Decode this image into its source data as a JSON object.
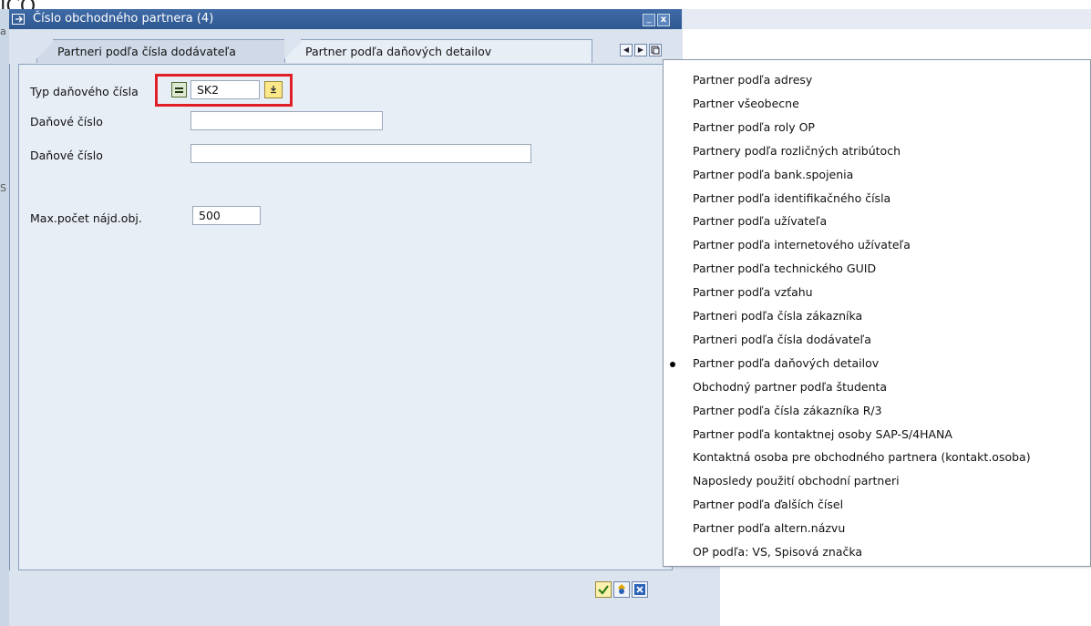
{
  "background": {
    "cut_text": "ICO.",
    "left_labels": [
      "a",
      "S"
    ]
  },
  "dialog": {
    "title": "Číslo obchodného partnera (4)",
    "minimize_label": "_",
    "close_label": "x"
  },
  "tabs": [
    {
      "label": "Partneri podľa čísla dodávateľa",
      "active": false
    },
    {
      "label": "Partner podľa daňových detailov",
      "active": true
    }
  ],
  "form": {
    "fields": [
      {
        "label": "Typ daňového čísla",
        "value": "SK2"
      },
      {
        "label": "Daňové číslo",
        "value": ""
      },
      {
        "label": "Daňové číslo",
        "value": ""
      },
      {
        "label": "Max.počet nájd.obj.",
        "value": "500"
      }
    ],
    "highlight_color": "#e11f26"
  },
  "menu": {
    "items": [
      "Partner podľa adresy",
      "Partner všeobecne",
      "Partner podľa roly OP",
      "Partnery podľa rozličných atribútoch",
      "Partner podľa bank.spojenia",
      "Partner podľa identifikačného čísla",
      "Partner podľa užívateľa",
      "Partner podľa internetového užívateľa",
      "Partner podľa technického GUID",
      "Partner podľa vzťahu",
      "Partneri podľa čísla zákazníka",
      "Partneri podľa čísla dodávateľa",
      "Partner podľa daňových detailov",
      "Obchodný partner podľa študenta",
      "Partner podľa čísla zákazníka R/3",
      "Partner podľa kontaktnej osoby SAP-S/4HANA",
      "Kontaktná osoba pre obchodného partnera (kontakt.osoba)",
      "Naposledy použití obchodní partneri",
      "Partner podľa ďalších čísel",
      "Partner podľa altern.názvu",
      "OP podľa: VS, Spisová značka"
    ],
    "selected_index": 12
  },
  "footer": {
    "buttons": [
      "confirm-icon",
      "search-icon",
      "cancel-icon"
    ]
  },
  "colors": {
    "titlebar": "#2f5890",
    "panel": "#e8eef6",
    "highlight": "#e11f26"
  }
}
